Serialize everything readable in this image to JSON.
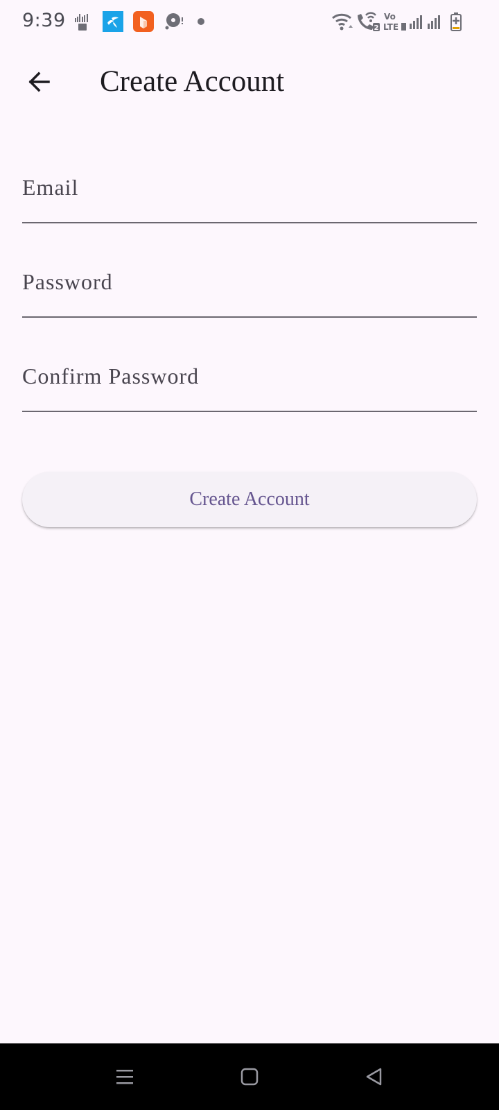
{
  "status_bar": {
    "time": "9:39",
    "icons": [
      "sim-network-icon",
      "telenor-app-icon",
      "orange-app-icon",
      "camera-icon",
      "dot-icon",
      "wifi-icon",
      "wifi-call-icon",
      "volte-icon",
      "signal-1-icon",
      "signal-2-icon",
      "battery-charging-icon"
    ],
    "volte_text": "Vo\nLTE",
    "call_sim_badge": "2"
  },
  "app_bar": {
    "title": "Create Account"
  },
  "form": {
    "email_placeholder": "Email",
    "password_placeholder": "Password",
    "confirm_password_placeholder": "Confirm Password",
    "submit_label": "Create Account"
  },
  "colors": {
    "background": "#fdf7fd",
    "accent": "#65558f",
    "button_bg": "#f5f1f7",
    "underline": "#6b6770"
  },
  "nav_bar": {
    "icons": [
      "recent-apps-icon",
      "home-icon",
      "back-nav-icon"
    ]
  }
}
